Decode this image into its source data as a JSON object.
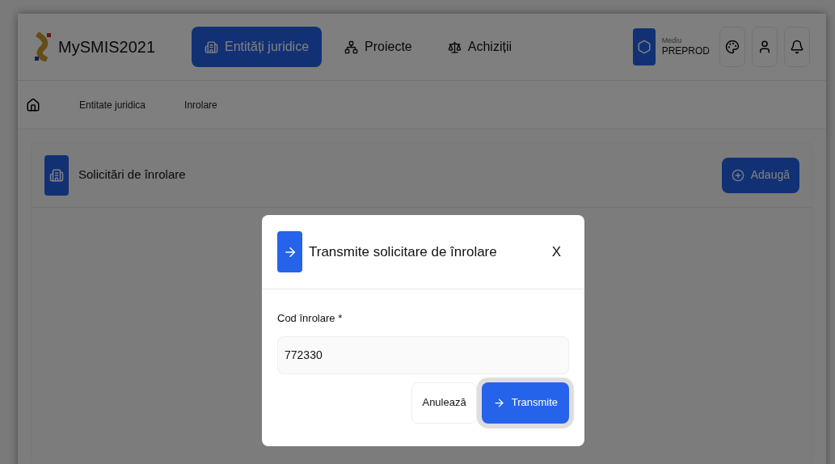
{
  "header": {
    "logo_text": "MySMIS2021",
    "nav": [
      {
        "label": "Entități juridice",
        "selected": true,
        "kind": "building"
      },
      {
        "label": "Proiecte",
        "selected": false,
        "kind": "tree"
      },
      {
        "label": "Achiziții",
        "selected": false,
        "kind": "scale"
      }
    ],
    "environment": {
      "label": "Mediu",
      "value": "PREPROD"
    }
  },
  "breadcrumb": [
    "Entitate juridica",
    "Inrolare"
  ],
  "panel": {
    "title": "Solicitări de înrolare",
    "add_button": "Adaugă"
  },
  "dialog": {
    "title": "Transmite solicitare de înrolare",
    "close": "X",
    "field": {
      "label": "Cod înrolare *",
      "value": "772330"
    },
    "cancel_button": "Anulează",
    "submit_button": "Transmite"
  }
}
